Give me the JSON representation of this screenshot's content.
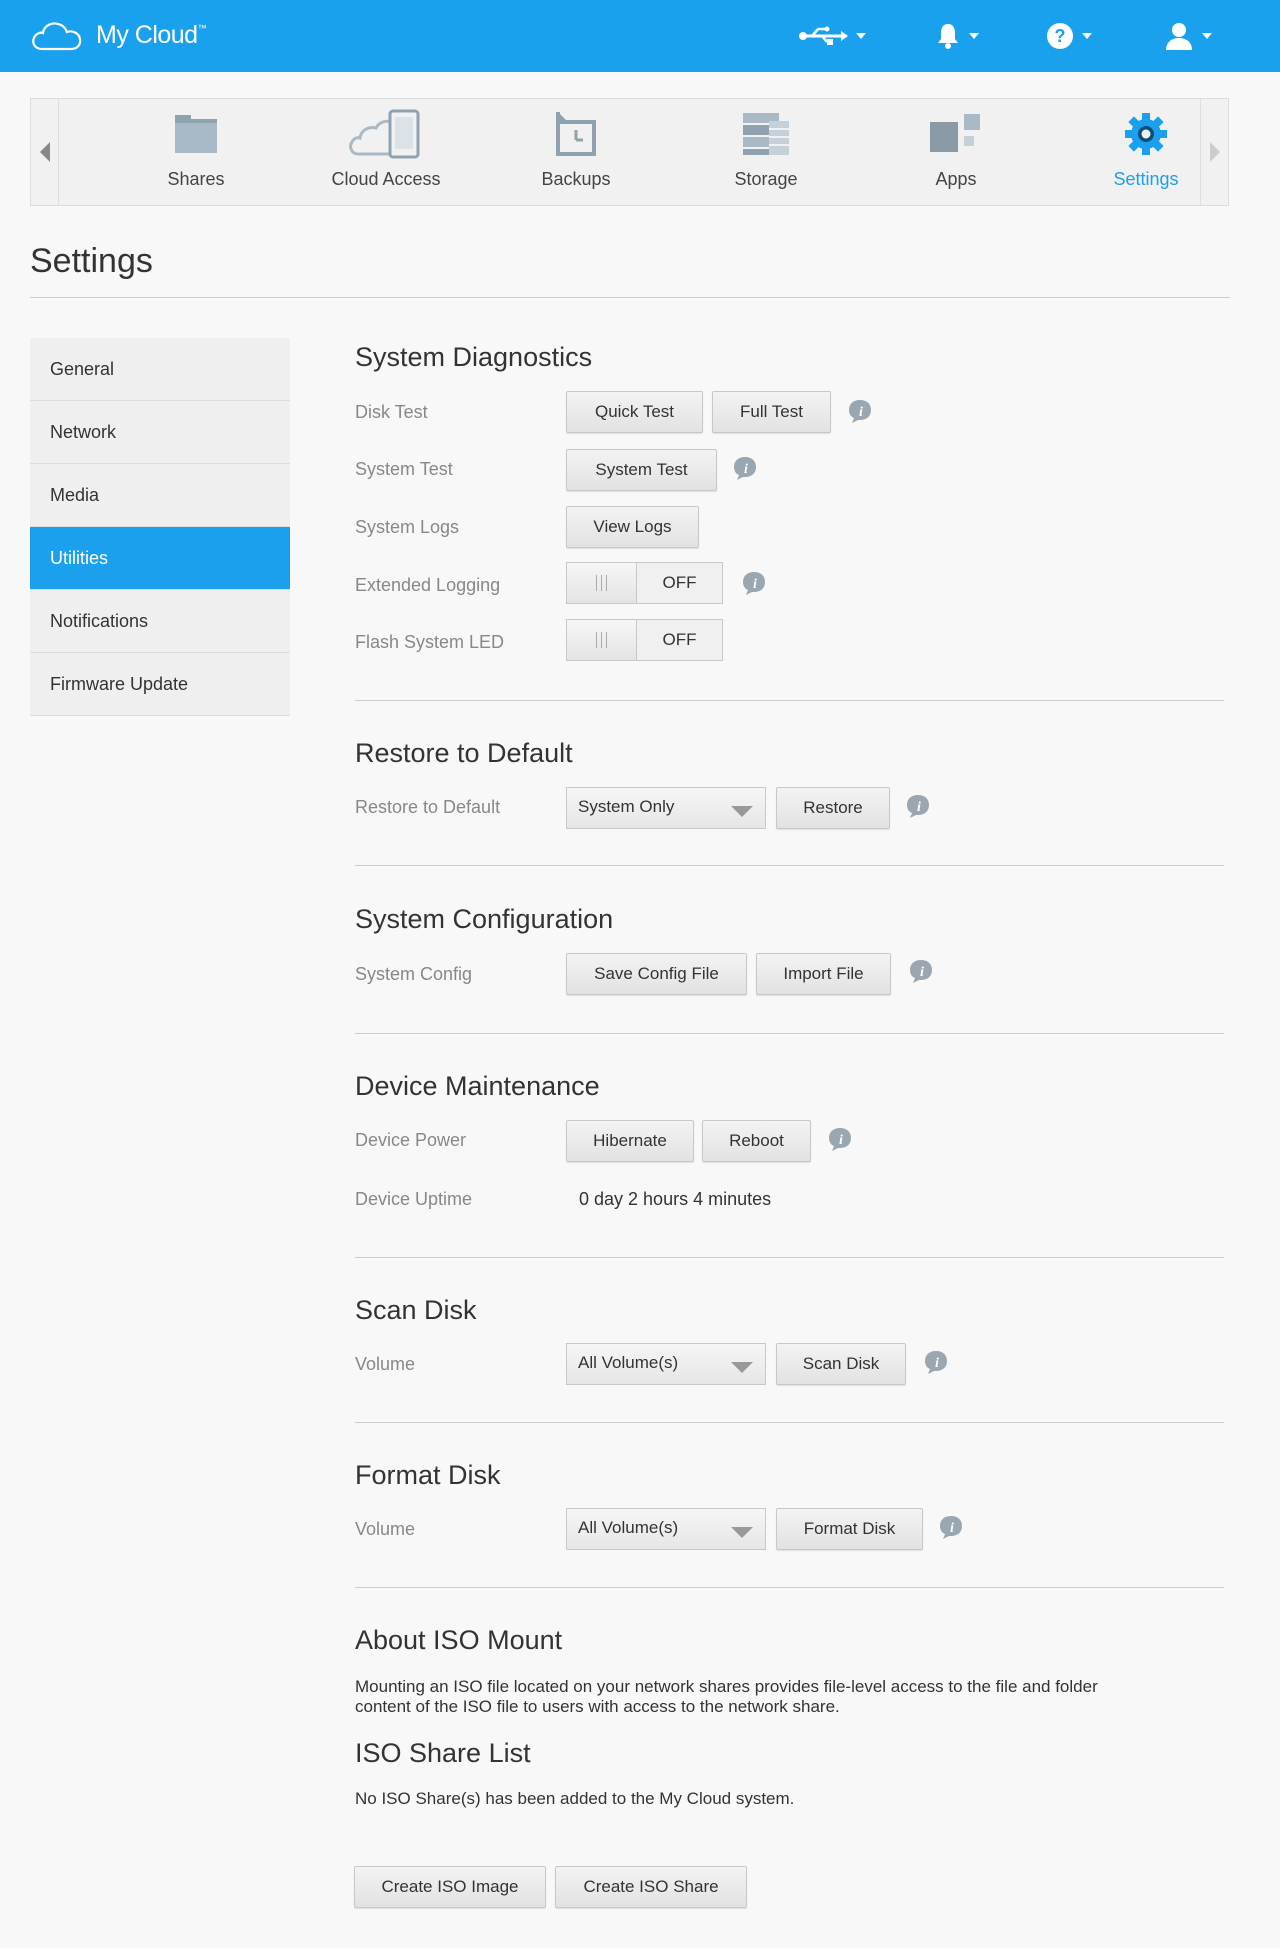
{
  "app": {
    "name": "My Cloud",
    "tm": "™"
  },
  "topbar": {
    "icons": [
      "usb-icon",
      "bell-icon",
      "help-icon",
      "user-icon"
    ]
  },
  "nav": {
    "items": [
      {
        "label": "Shares",
        "icon": "folder-icon"
      },
      {
        "label": "Cloud Access",
        "icon": "cloud-device-icon"
      },
      {
        "label": "Backups",
        "icon": "backup-icon"
      },
      {
        "label": "Storage",
        "icon": "storage-icon"
      },
      {
        "label": "Apps",
        "icon": "apps-icon"
      },
      {
        "label": "Settings",
        "icon": "gear-icon"
      }
    ],
    "active": "Settings"
  },
  "page": {
    "title": "Settings"
  },
  "sidebar": {
    "items": [
      {
        "label": "General"
      },
      {
        "label": "Network"
      },
      {
        "label": "Media"
      },
      {
        "label": "Utilities"
      },
      {
        "label": "Notifications"
      },
      {
        "label": "Firmware Update"
      }
    ],
    "active": "Utilities"
  },
  "diagnostics": {
    "title": "System Diagnostics",
    "disk_test_label": "Disk Test",
    "quick_test": "Quick Test",
    "full_test": "Full Test",
    "system_test_label": "System Test",
    "system_test_button": "System Test",
    "logs_label": "System Logs",
    "view_logs": "View Logs",
    "ext_logging_label": "Extended Logging",
    "ext_logging_state": "OFF",
    "flash_led_label": "Flash System LED",
    "flash_led_state": "OFF"
  },
  "restore": {
    "title": "Restore to Default",
    "label": "Restore to Default",
    "option": "System Only",
    "button": "Restore"
  },
  "config": {
    "title": "System Configuration",
    "label": "System Config",
    "save": "Save Config File",
    "import": "Import File"
  },
  "maintenance": {
    "title": "Device Maintenance",
    "power_label": "Device Power",
    "hibernate": "Hibernate",
    "reboot": "Reboot",
    "uptime_label": "Device Uptime",
    "uptime_value": "0 day 2 hours 4 minutes"
  },
  "scan": {
    "title": "Scan Disk",
    "label": "Volume",
    "option": "All Volume(s)",
    "button": "Scan Disk"
  },
  "format": {
    "title": "Format Disk",
    "label": "Volume",
    "option": "All Volume(s)",
    "button": "Format Disk"
  },
  "iso": {
    "about_title": "About ISO Mount",
    "about_line1": "Mounting an ISO file located on your network shares provides file-level access to the file and folder",
    "about_line2": "content of the ISO file to users with access to the network share.",
    "list_title": "ISO Share List",
    "list_text": "No ISO Share(s) has been added to the My Cloud system.",
    "create_image": "Create ISO Image",
    "create_share": "Create ISO Share"
  },
  "colors": {
    "accent": "#1ba0ee",
    "topbar": "#19a1ee"
  }
}
